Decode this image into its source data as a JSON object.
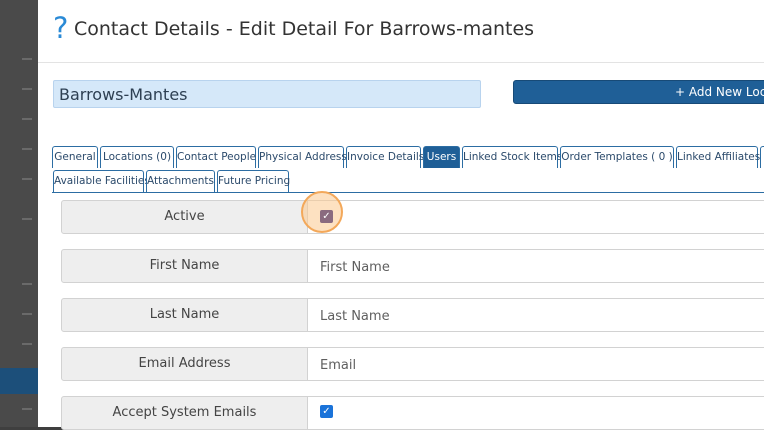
{
  "header": {
    "help_icon": "?",
    "title": "Contact Details - Edit Detail For Barrows-mantes"
  },
  "contact_name": "Barrows-Mantes",
  "add_location_button": "+ Add New Loca",
  "tabs_row1": [
    "General",
    "Locations (0)",
    "Contact People",
    "Physical Address",
    "Invoice Details",
    "Users",
    "Linked Stock Items",
    "Order Templates ( 0 )",
    "Linked Affiliates"
  ],
  "tabs_row2": [
    "Available Facilities",
    "Attachments",
    "Future Pricing"
  ],
  "active_tab": "Users",
  "form": {
    "active_label": "Active",
    "first_name_label": "First Name",
    "first_name_placeholder": "First Name",
    "last_name_label": "Last Name",
    "last_name_placeholder": "Last Name",
    "email_label": "Email Address",
    "email_placeholder": "Email",
    "accept_emails_label": "Accept System Emails"
  },
  "checkbox_states": {
    "active": true,
    "accept_system_emails": true
  },
  "colors": {
    "accent": "#1f5f97",
    "help_icon": "#2a8ad6",
    "focus_ring": "#f3a85a"
  },
  "icons": {
    "checkbox_check": "✓"
  }
}
